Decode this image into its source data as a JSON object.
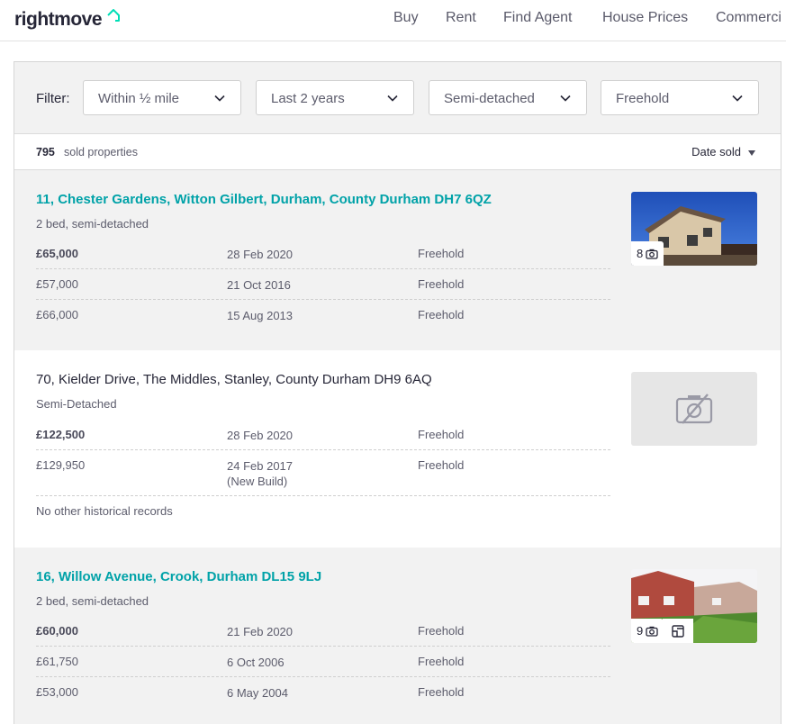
{
  "header": {
    "logo": "rightmove",
    "nav": [
      "Buy",
      "Rent",
      "Find Agent",
      "House Prices",
      "Commerci"
    ]
  },
  "filters": {
    "label": "Filter:",
    "radius": "Within ½ mile",
    "period": "Last 2 years",
    "type": "Semi-detached",
    "tenure": "Freehold"
  },
  "results": {
    "count": "795",
    "count_label": "sold properties",
    "sort_label": "Date sold"
  },
  "properties": [
    {
      "address": "11, Chester Gardens, Witton Gilbert, Durham, County Durham DH7 6QZ",
      "description": "2 bed, semi-detached",
      "photo_count": "8",
      "sales": [
        {
          "price": "£65,000",
          "date": "28 Feb 2020",
          "tenure": "Freehold"
        },
        {
          "price": "£57,000",
          "date": "21 Oct 2016",
          "tenure": "Freehold"
        },
        {
          "price": "£66,000",
          "date": "15 Aug 2013",
          "tenure": "Freehold"
        }
      ]
    },
    {
      "address": "70, Kielder Drive, The Middles, Stanley, County Durham DH9 6AQ",
      "description": "Semi-Detached",
      "sales": [
        {
          "price": "£122,500",
          "date": "28 Feb 2020",
          "tenure": "Freehold"
        },
        {
          "price": "£129,950",
          "date": "24 Feb 2017",
          "date_note": "(New Build)",
          "tenure": "Freehold"
        }
      ],
      "note": "No other historical records"
    },
    {
      "address": "16, Willow Avenue, Crook, Durham DL15 9LJ",
      "description": "2 bed, semi-detached",
      "photo_count": "9",
      "sales": [
        {
          "price": "£60,000",
          "date": "21 Feb 2020",
          "tenure": "Freehold"
        },
        {
          "price": "£61,750",
          "date": "6 Oct 2006",
          "tenure": "Freehold"
        },
        {
          "price": "£53,000",
          "date": "6 May 2004",
          "tenure": "Freehold"
        }
      ]
    }
  ],
  "colors": {
    "brand_teal": "#00a2a8",
    "text_dark": "#262637",
    "text_muted": "#5c5c6c",
    "panel_grey": "#f2f2f2"
  },
  "icons": [
    "home-roof-icon",
    "chevron-down-icon",
    "camera-icon",
    "floorplan-icon",
    "no-photo-icon",
    "sort-arrow-icon"
  ]
}
